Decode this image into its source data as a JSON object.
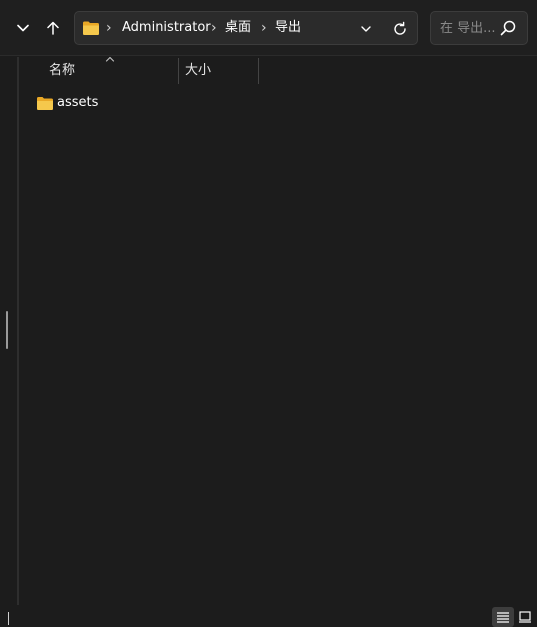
{
  "address_bar": {
    "breadcrumbs": [
      "Administrator",
      "桌面",
      "导出"
    ],
    "separator": "›"
  },
  "search": {
    "placeholder": "在 导出..."
  },
  "columns": {
    "name": "名称",
    "size": "大小"
  },
  "files": [
    {
      "name": "assets",
      "icon": "folder-icon"
    }
  ],
  "icons": {
    "back": "chevron-down-icon",
    "up": "arrow-up-icon",
    "refresh": "refresh-icon",
    "search": "search-icon",
    "details_view": "details-view-icon",
    "tiles_view": "tiles-view-icon"
  },
  "colors": {
    "background": "#1c1c1c",
    "folder": "#f2c14e",
    "text": "#ffffff"
  }
}
